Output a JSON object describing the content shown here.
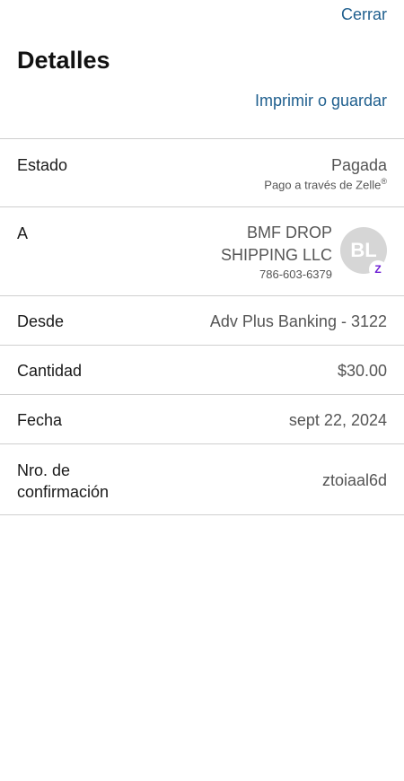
{
  "header": {
    "close_label": "Cerrar",
    "title": "Detalles",
    "print_label": "Imprimir o guardar"
  },
  "details": {
    "status": {
      "label": "Estado",
      "value": "Pagada",
      "sub": "Pago a través de Zelle",
      "sub_mark": "®"
    },
    "recipient": {
      "label": "A",
      "name": "BMF DROP SHIPPING LLC",
      "phone": "786-603-6379",
      "avatar_initials": "BL",
      "badge_icon": "zelle-icon",
      "badge_text": "Z"
    },
    "from": {
      "label": "Desde",
      "value": "Adv Plus Banking - 3122"
    },
    "amount": {
      "label": "Cantidad",
      "value": "$30.00"
    },
    "date": {
      "label": "Fecha",
      "value": "sept 22, 2024"
    },
    "confirmation": {
      "label": "Nro. de confirmación",
      "value": "ztoiaal6d"
    }
  },
  "colors": {
    "link": "#1f5f8e",
    "avatar_bg": "#d6d6d6",
    "zelle_purple": "#6d1ed4",
    "divider": "#cfcfcf"
  }
}
